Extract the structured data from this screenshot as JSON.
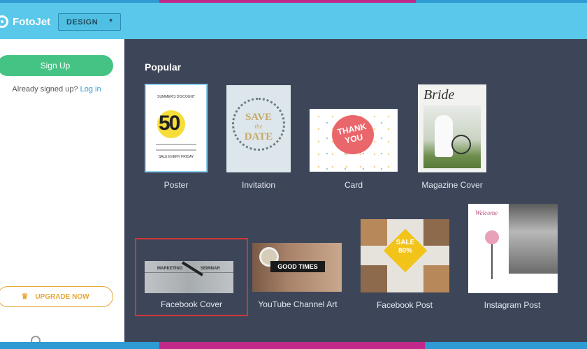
{
  "header": {
    "app_name": "FotoJet",
    "design_select": "DESIGN"
  },
  "sidebar": {
    "signup_label": "Sign Up",
    "already_text": "Already signed up?",
    "login_link": "Log in",
    "upgrade_label": "UPGRADE NOW"
  },
  "main": {
    "section_title": "Popular",
    "items": [
      {
        "label": "Poster"
      },
      {
        "label": "Invitation"
      },
      {
        "label": "Card"
      },
      {
        "label": "Magazine Cover"
      },
      {
        "label": "Facebook Cover"
      },
      {
        "label": "YouTube Channel Art"
      },
      {
        "label": "Facebook Post"
      },
      {
        "label": "Instagram Post"
      }
    ]
  },
  "thumbs": {
    "poster": {
      "headline": "SUMMER'S DISCOUNT",
      "big": "50",
      "footer": "SALE EVERY FRIDAY"
    },
    "invitation": {
      "line1": "SAVE",
      "line2": "the",
      "line3": "DATE"
    },
    "card": {
      "text": "THANK YOU"
    },
    "magazine": {
      "title": "Bride"
    },
    "fbcover": {
      "left": "MARKETING",
      "right": "SEMINAR"
    },
    "youtube": {
      "text": "GOOD TIMES"
    },
    "fbpost": {
      "sale": "SALE",
      "pct": "80%"
    },
    "insta": {
      "welcome": "Welcome"
    }
  },
  "colors": {
    "header": "#59c8ea",
    "main_bg": "#3d4659",
    "signup": "#45c385",
    "upgrade": "#e5a83a",
    "highlight": "#d23535"
  }
}
